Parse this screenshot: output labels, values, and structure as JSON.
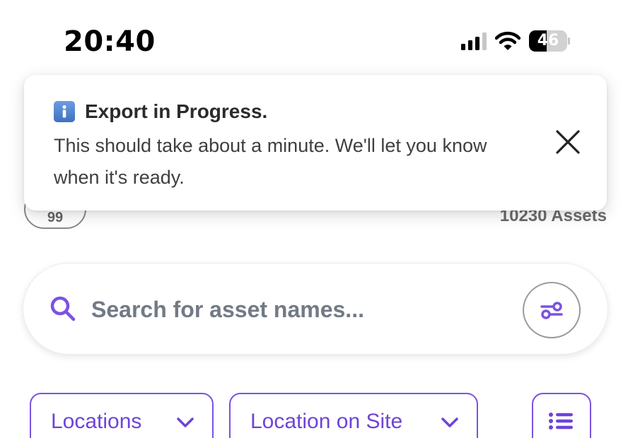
{
  "status_bar": {
    "time": "20:40",
    "battery_level": "46",
    "signal_bars_filled": 3,
    "signal_bars_total": 4,
    "icons": [
      "cellular-signal-icon",
      "wifi-icon",
      "battery-icon"
    ]
  },
  "header": {
    "count_chip": "99",
    "asset_count": "10230 Assets"
  },
  "toast": {
    "icon": "info-icon",
    "title": "Export in Progress.",
    "message": "This should take about a minute. We'll let you know when it's ready.",
    "close_icon": "close-icon"
  },
  "search": {
    "placeholder": "Search for asset names...",
    "value": "",
    "search_icon": "search-icon",
    "filter_icon": "sliders-icon"
  },
  "filters": {
    "locations_label": "Locations",
    "location_on_site_label": "Location on Site",
    "list_view_icon": "list-icon"
  },
  "colors": {
    "accent": "#7b52e3",
    "accent_text": "#6d44d8",
    "placeholder_text": "#727a85",
    "info_icon_blue": "#4f82cf"
  }
}
